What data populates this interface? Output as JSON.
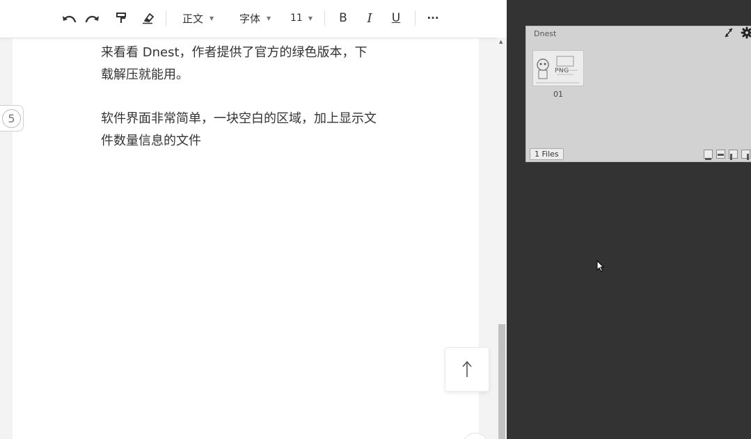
{
  "toolbar": {
    "undo_icon": "undo-icon",
    "redo_icon": "redo-icon",
    "format_painter_icon": "format-painter-icon",
    "eraser_icon": "eraser-icon",
    "style_select": "正文",
    "font_select": "字体",
    "size_select": "11",
    "bold_label": "B",
    "italic_label": "I",
    "underline_label": "U",
    "more_label": "···"
  },
  "document": {
    "paragraphs": [
      {
        "lines": [
          "来看看 Dnest，作者提供了官方的绿色版本，下",
          "载解压就能用。"
        ]
      },
      {
        "lines": [
          "软件界面非常简单，一块空白的区域，加上显示文",
          "件数量信息的文件"
        ]
      }
    ],
    "paragraph_number": "5",
    "back_to_top_icon": "arrow-up-icon"
  },
  "dnest": {
    "title": "Dnest",
    "thumbnail": {
      "badge": "PNG",
      "name": "01"
    },
    "files_count": "1 Files",
    "icons": [
      "collapse-icon",
      "gear-icon",
      "layout-bottom-icon",
      "layout-top-icon",
      "layout-left-icon",
      "layout-right-icon"
    ]
  },
  "colors": {
    "desktop": "#333333",
    "page": "#ffffff",
    "widget": "#d2d2d2",
    "text": "#333333"
  }
}
